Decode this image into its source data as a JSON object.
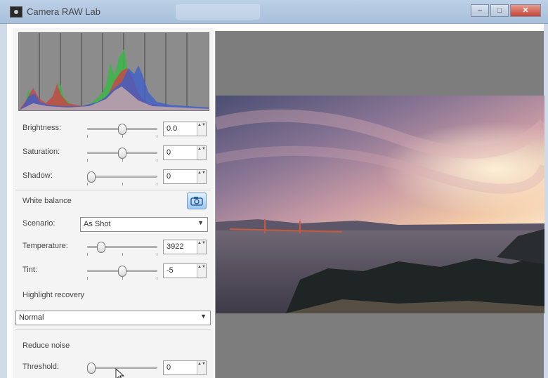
{
  "window": {
    "title": "Camera RAW Lab",
    "controls": [
      "minimize",
      "maximize",
      "close"
    ],
    "control_glyphs": [
      "–",
      "□",
      "✕"
    ]
  },
  "histogram": {
    "icon": "histogram-graph",
    "channels": [
      "red",
      "green",
      "blue",
      "luminance"
    ]
  },
  "adjustments": {
    "brightness": {
      "label": "Brightness:",
      "value": "0.0",
      "slider_position": 0.5
    },
    "saturation": {
      "label": "Saturation:",
      "value": "0",
      "slider_position": 0.5
    },
    "shadow": {
      "label": "Shadow:",
      "value": "0",
      "slider_position": 0.0
    }
  },
  "white_balance": {
    "label": "White balance",
    "picker_icon": "white-balance-picker-icon",
    "scenario": {
      "label": "Scenario:",
      "value": "As Shot"
    },
    "temperature": {
      "label": "Temperature:",
      "value": "3922",
      "slider_position": 0.2
    },
    "tint": {
      "label": "Tint:",
      "value": "-5",
      "slider_position": 0.5
    }
  },
  "highlight_recovery": {
    "label": "Highlight recovery",
    "value": "Normal"
  },
  "noise": {
    "label": "Reduce noise",
    "threshold": {
      "label": "Threshold:",
      "value": "0",
      "slider_position": 0.0
    }
  },
  "spin_arrows": "▲▼",
  "dropdown_arrow": "▼",
  "preview": {
    "content": "sunset-over-bay-photo"
  },
  "colors": {
    "titlebar": "#b3c8e0",
    "panel_bg": "#f4f4f4",
    "preview_bg": "#7d7d7d",
    "histogram_bg": "#8c8c8c",
    "accent": "#6f9bd0"
  }
}
